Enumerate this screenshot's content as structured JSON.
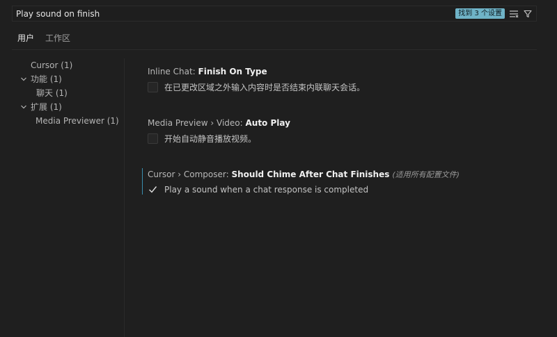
{
  "search": {
    "value": "Play sound on finish",
    "result_badge": "找到 3 个设置",
    "filter_list_icon": "filter-list-icon",
    "funnel_icon": "funnel-icon"
  },
  "tabs": [
    {
      "label": "用户",
      "active": true
    },
    {
      "label": "工作区",
      "active": false
    }
  ],
  "toc": {
    "items": [
      {
        "label": "Cursor (1)",
        "expandable": false
      },
      {
        "label": "功能 (1)",
        "expandable": true
      },
      {
        "label": "聊天 (1)",
        "expandable": false
      },
      {
        "label": "扩展 (1)",
        "expandable": true
      },
      {
        "label": "Media Previewer (1)",
        "expandable": false
      }
    ]
  },
  "settings": [
    {
      "category": "Inline Chat: ",
      "name": "Finish On Type",
      "scope": "",
      "description": "在已更改区域之外输入内容时是否结束内联聊天会话。",
      "checked": false
    },
    {
      "category": "Media Preview › Video: ",
      "name": "Auto Play",
      "scope": "",
      "description": "开始自动静音播放视频。",
      "checked": false
    },
    {
      "category": "Cursor › Composer: ",
      "name": "Should Chime After Chat Finishes",
      "scope": "(适用所有配置文件)",
      "description": "Play a sound when a chat response is completed",
      "checked": true
    }
  ],
  "colors": {
    "background": "#1f1f1f",
    "badge": "#6fb3c7",
    "focus_accent": "#3a8fb0"
  }
}
